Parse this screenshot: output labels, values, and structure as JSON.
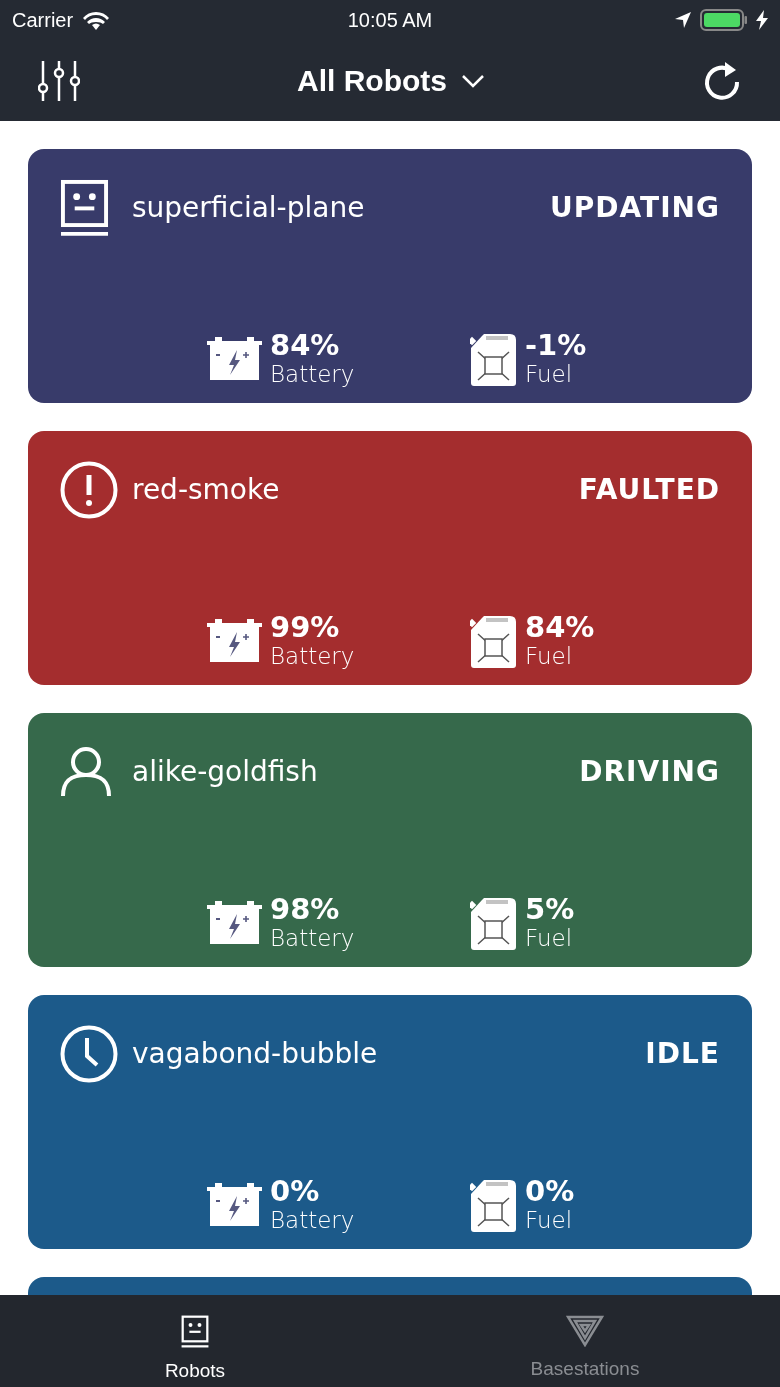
{
  "status_bar": {
    "carrier": "Carrier",
    "time": "10:05 AM"
  },
  "nav": {
    "title": "All Robots"
  },
  "robots": [
    {
      "name": "superficial-plane",
      "status": "UPDATING",
      "kind": "robot",
      "color": "#383b6a",
      "battery": "84%",
      "battery_label": "Battery",
      "fuel": "-1%",
      "fuel_label": "Fuel"
    },
    {
      "name": "red-smoke",
      "status": "FAULTED",
      "kind": "alert",
      "color": "#a42d2e",
      "battery": "99%",
      "battery_label": "Battery",
      "fuel": "84%",
      "fuel_label": "Fuel"
    },
    {
      "name": "alike-goldfish",
      "status": "DRIVING",
      "kind": "person",
      "color": "#36694b",
      "battery": "98%",
      "battery_label": "Battery",
      "fuel": "5%",
      "fuel_label": "Fuel"
    },
    {
      "name": "vagabond-bubble",
      "status": "IDLE",
      "kind": "clock",
      "color": "#1c5a8a",
      "battery": "0%",
      "battery_label": "Battery",
      "fuel": "0%",
      "fuel_label": "Fuel"
    }
  ],
  "next_card": {
    "color": "#1c5a8a"
  },
  "tabs": [
    {
      "label": "Robots",
      "kind": "robot",
      "selected": true
    },
    {
      "label": "Basestations",
      "kind": "base",
      "selected": false
    }
  ]
}
